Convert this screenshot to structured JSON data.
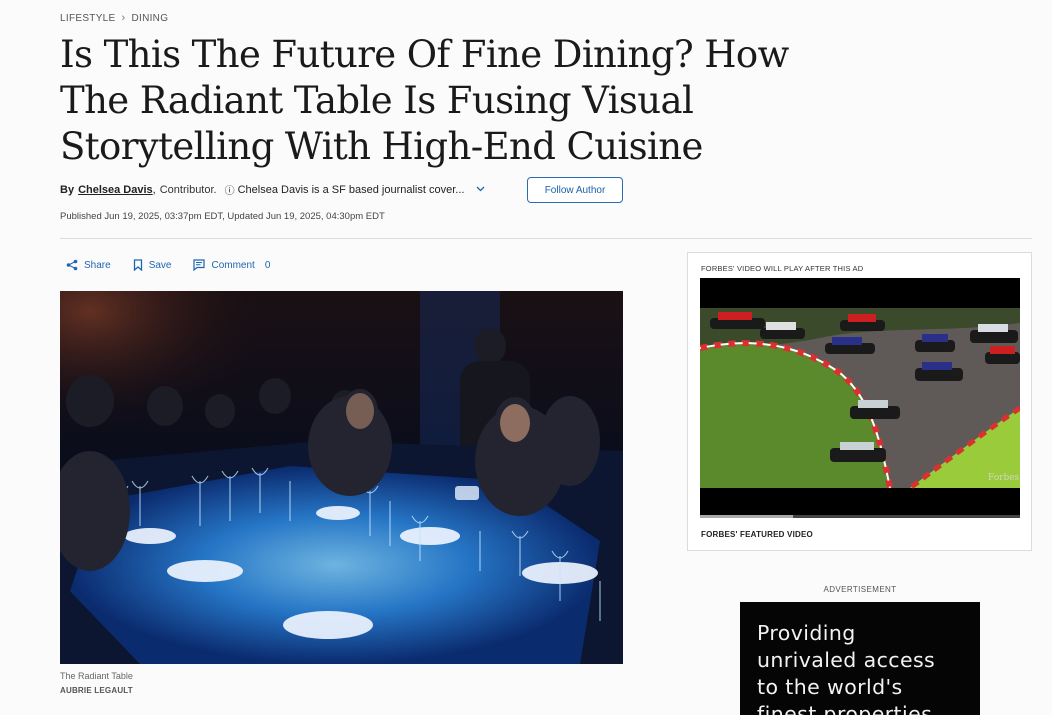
{
  "breadcrumb": {
    "section": "LIFESTYLE",
    "subsection": "DINING"
  },
  "article": {
    "title": "Is This The Future Of Fine Dining? How The Radiant Table Is Fusing Visual Storytelling With High-End Cuisine",
    "by_label": "By",
    "author": "Chelsea Davis",
    "author_suffix": ",",
    "role": "Contributor.",
    "bio": "Chelsea Davis is a SF based journalist cover...",
    "follow_label": "Follow Author",
    "published": "Published Jun 19, 2025, 03:37pm EDT, Updated Jun 19, 2025, 04:30pm EDT"
  },
  "actions": {
    "share": "Share",
    "save": "Save",
    "comment": "Comment",
    "comment_count": "0"
  },
  "photo": {
    "caption": "The Radiant Table",
    "credit": "AUBRIE LEGAULT"
  },
  "video": {
    "note": "FORBES' VIDEO WILL PLAY AFTER THIS AD",
    "label": "FORBES' FEATURED VIDEO",
    "watermark": "Forbes",
    "progress": 0.29
  },
  "ad": {
    "label": "ADVERTISEMENT",
    "text": "Providing\nunrivaled access\nto the world's\nfinest properties"
  },
  "colors": {
    "link_blue": "#1f66b0",
    "follow_border": "#2a6bb5"
  }
}
